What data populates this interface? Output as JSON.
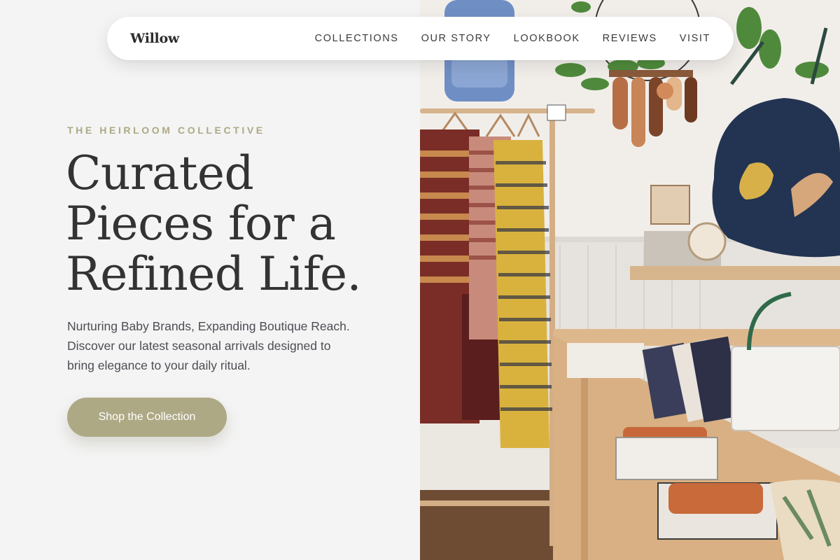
{
  "nav": {
    "brand": "Willow",
    "links": [
      "COLLECTIONS",
      "OUR STORY",
      "LOOKBOOK",
      "REVIEWS",
      "VISIT"
    ]
  },
  "hero": {
    "eyebrow": "THE HEIRLOOM COLLECTIVE",
    "headline_lines": [
      "Curated",
      "Pieces for a",
      "Refined Life."
    ],
    "subtext": "Nurturing Baby Brands, Expanding Boutique Reach. Discover our latest seasonal arrivals designed to bring elegance to your daily ritual.",
    "cta_label": "Shop the Collection"
  },
  "colors": {
    "accent": "#aea985",
    "page_background": "#f4f4f4",
    "heading_text": "#333333",
    "body_text": "#4d4d55",
    "nav_background": "#ffffff"
  },
  "image": {
    "subject": "boutique-interior-photo"
  }
}
